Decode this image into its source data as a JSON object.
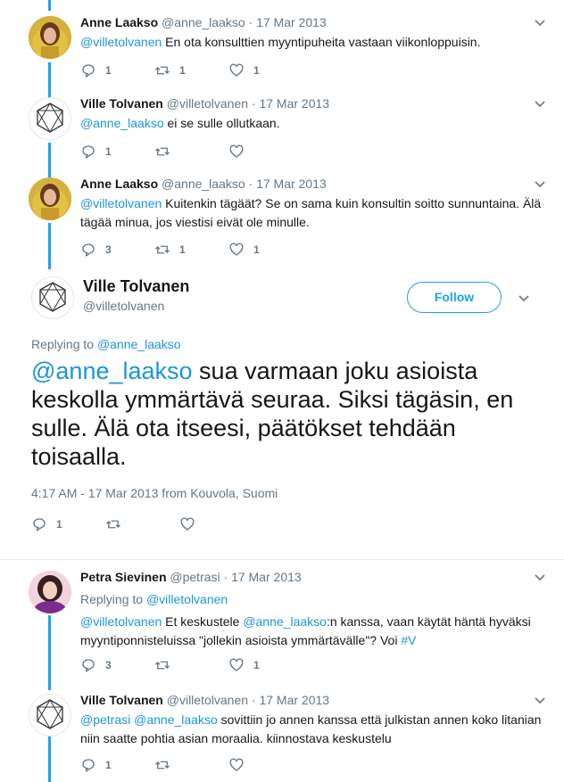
{
  "tweets": [
    {
      "name": "Anne Laakso",
      "meta": "@anne_laakso · 17 Mar 2013",
      "mention": "@villetolvanen",
      "text": " En ota konsulttien myyntipuheita vastaan viikonloppuisin.",
      "replies": "1",
      "retweets": "1",
      "likes": "1"
    },
    {
      "name": "Ville Tolvanen",
      "meta": "@villetolvanen · 17 Mar 2013",
      "mention": "@anne_laakso",
      "text": " ei se sulle ollutkaan.",
      "replies": "1",
      "retweets": "",
      "likes": ""
    },
    {
      "name": "Anne Laakso",
      "meta": "@anne_laakso · 17 Mar 2013",
      "mention": "@villetolvanen",
      "text": " Kuitenkin tägäät? Se on sama kuin konsultin soitto sunnuntaina. Älä tägää minua, jos viestisi eivät ole minulle.",
      "replies": "3",
      "retweets": "1",
      "likes": "1"
    }
  ],
  "focused": {
    "name": "Ville Tolvanen",
    "handle": "@villetolvanen",
    "follow_label": "Follow",
    "replying_prefix": "Replying to ",
    "replying_to": "@anne_laakso",
    "mention": "@anne_laakso",
    "text": " sua varmaan joku asioista keskolla ymmärtävä seuraa. Siksi tägäsin, en sulle. Älä ota itseesi, päätökset tehdään toisaalla.",
    "timestamp": "4:17 AM - 17 Mar 2013 from Kouvola, Suomi",
    "replies": "1",
    "retweets": "",
    "likes": ""
  },
  "replies": [
    {
      "name": "Petra Sievinen",
      "meta": "@petrasi · 17 Mar 2013",
      "replying_prefix": "Replying to ",
      "replying_to": "@villetolvanen",
      "mention1": "@villetolvanen",
      "text1": " Et keskustele ",
      "mention2": "@anne_laakso",
      "text2": ":n kanssa, vaan käytät häntä hyväksi myyntiponnisteluissa \"jollekin asioista ymmärtävälle\"? Voi ",
      "hashtag": "#V",
      "replies": "3",
      "retweets": "",
      "likes": "1"
    },
    {
      "name": "Ville Tolvanen",
      "meta": "@villetolvanen · 17 Mar 2013",
      "mention1": "@petrasi",
      "mention2": "@anne_laakso",
      "text": " sovittiin jo annen kanssa että julkistan annen koko litanian niin saatte pohtia asian moraalia. kiinnostava keskustelu",
      "replies": "1",
      "retweets": "",
      "likes": ""
    }
  ],
  "colors": {
    "accent": "#1da1f2",
    "link": "#1b95e0",
    "muted": "#657786",
    "text": "#14171a"
  },
  "icons": [
    "reply-icon",
    "retweet-icon",
    "like-icon",
    "chevron-down-icon"
  ]
}
